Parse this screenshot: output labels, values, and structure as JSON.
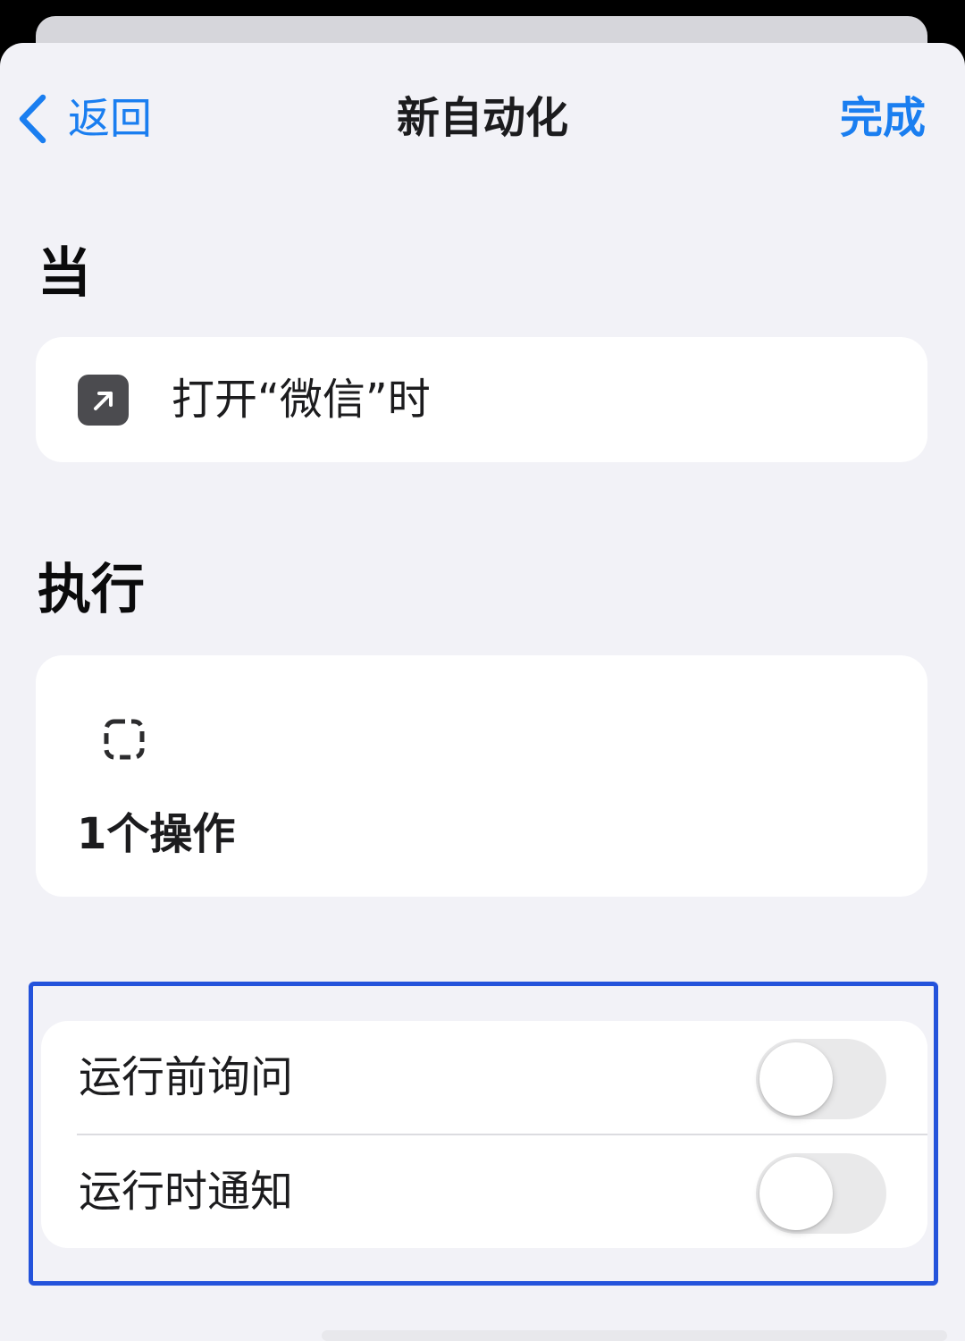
{
  "nav": {
    "back_label": "返回",
    "title": "新自动化",
    "done_label": "完成"
  },
  "when_section": {
    "title": "当",
    "trigger": {
      "icon": "arrow-up-right-icon",
      "text": "打开“微信”时"
    }
  },
  "do_section": {
    "title": "执行",
    "action": {
      "icon": "dashed-square-icon",
      "text": "1个操作"
    }
  },
  "settings": [
    {
      "label": "运行前询问",
      "enabled": false
    },
    {
      "label": "运行时通知",
      "enabled": false
    }
  ],
  "colors": {
    "accent": "#1a7ef0",
    "highlight_border": "#2453db",
    "background": "#f2f2f7"
  }
}
